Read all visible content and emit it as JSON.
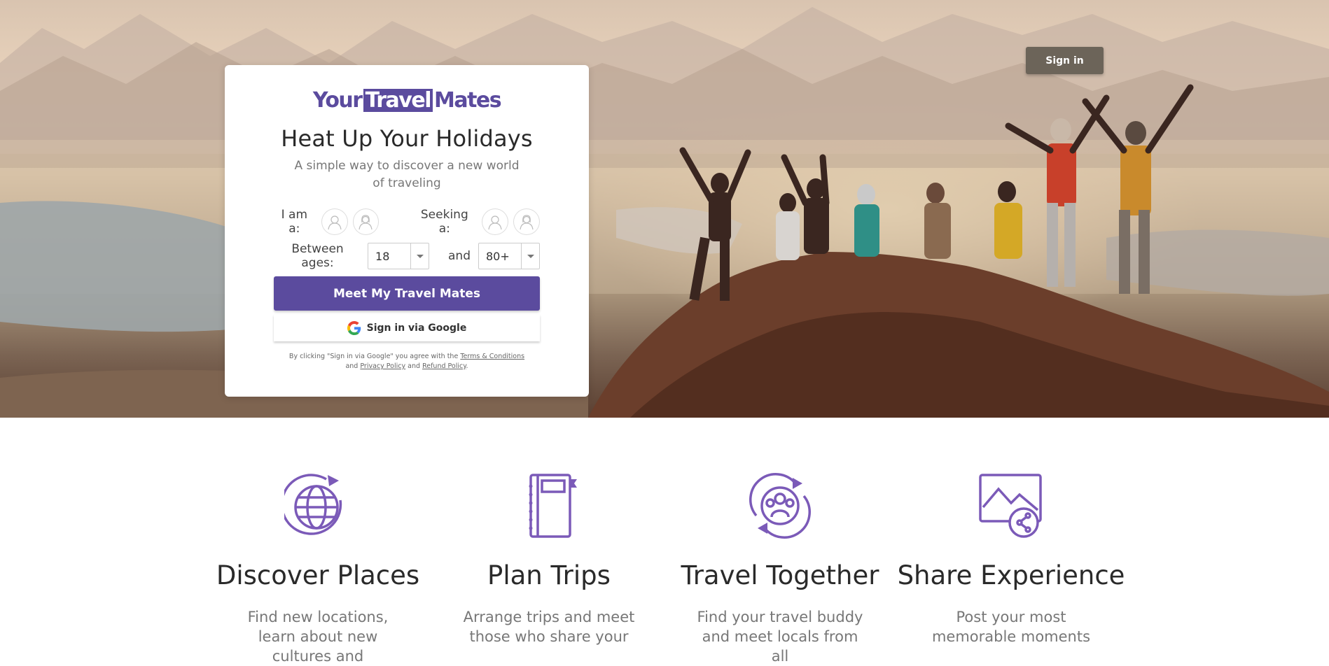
{
  "header": {
    "signin_label": "Sign in"
  },
  "card": {
    "logo": {
      "part1": "Your",
      "part2": "Travel",
      "part3": "Mates"
    },
    "title": "Heat Up Your Holidays",
    "subtitle": "A simple way to discover a new world of traveling",
    "i_am_label": "I am a:",
    "seeking_label": "Seeking a:",
    "between_label": "Between ages:",
    "age_from": "18",
    "and_label": "and",
    "age_to": "80+",
    "cta_label": "Meet My Travel Mates",
    "google_label": "Sign in via Google",
    "legal": {
      "prefix": "By clicking \"Sign in via Google\" you agree with the",
      "terms": "Terms & Conditions",
      "and1": "and",
      "privacy": "Privacy Policy",
      "and2": "and",
      "refund": "Refund Policy",
      "suffix": "."
    }
  },
  "features": [
    {
      "icon": "globe-icon",
      "title": "Discover Places",
      "text": "Find new locations, learn about new cultures and"
    },
    {
      "icon": "notebook-icon",
      "title": "Plan Trips",
      "text": "Arrange trips and meet those who share your"
    },
    {
      "icon": "group-icon",
      "title": "Travel Together",
      "text": "Find your travel buddy and meet locals from all"
    },
    {
      "icon": "share-photo-icon",
      "title": "Share Experience",
      "text": "Post your most memorable moments"
    }
  ],
  "colors": {
    "brand": "#5b4b9e",
    "icon": "#7b5ab8",
    "signin_bg": "#6c6459"
  }
}
